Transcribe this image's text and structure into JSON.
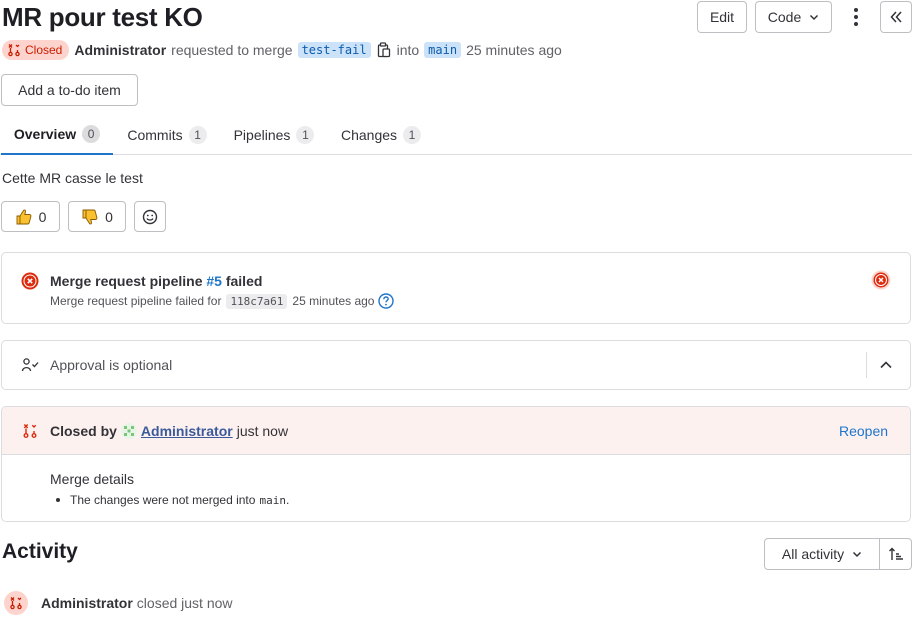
{
  "title": "MR pour test KO",
  "header": {
    "edit_label": "Edit",
    "code_label": "Code",
    "status_badge": "Closed",
    "author": "Administrator",
    "requested_text": "requested to merge",
    "source_branch": "test-fail",
    "into_text": "into",
    "target_branch": "main",
    "time_ago": "25 minutes ago",
    "todo_label": "Add a to-do item"
  },
  "tabs": [
    {
      "label": "Overview",
      "count": "0"
    },
    {
      "label": "Commits",
      "count": "1"
    },
    {
      "label": "Pipelines",
      "count": "1"
    },
    {
      "label": "Changes",
      "count": "1"
    }
  ],
  "description": "Cette MR casse le test",
  "reactions": {
    "thumbs_up": "0",
    "thumbs_down": "0"
  },
  "pipeline": {
    "title_prefix": "Merge request pipeline",
    "pipeline_id": "#5",
    "title_suffix": "failed",
    "detail_prefix": "Merge request pipeline failed for",
    "commit_sha": "118c7a61",
    "time_ago": "25 minutes ago"
  },
  "approval": {
    "text": "Approval is optional"
  },
  "closed": {
    "label": "Closed by",
    "user": "Administrator",
    "time": "just now",
    "reopen_label": "Reopen",
    "details_title": "Merge details",
    "detail_prefix": "The changes were not merged into",
    "detail_branch": "main",
    "detail_suffix": "."
  },
  "activity": {
    "title": "Activity",
    "filter_label": "All activity",
    "event_user": "Administrator",
    "event_text": "closed just now"
  },
  "colors": {
    "danger": "#dd2b0e",
    "danger_bg": "#fdd4cd",
    "link": "#1f75cb",
    "closed_banner_bg": "#fcf1ef"
  }
}
